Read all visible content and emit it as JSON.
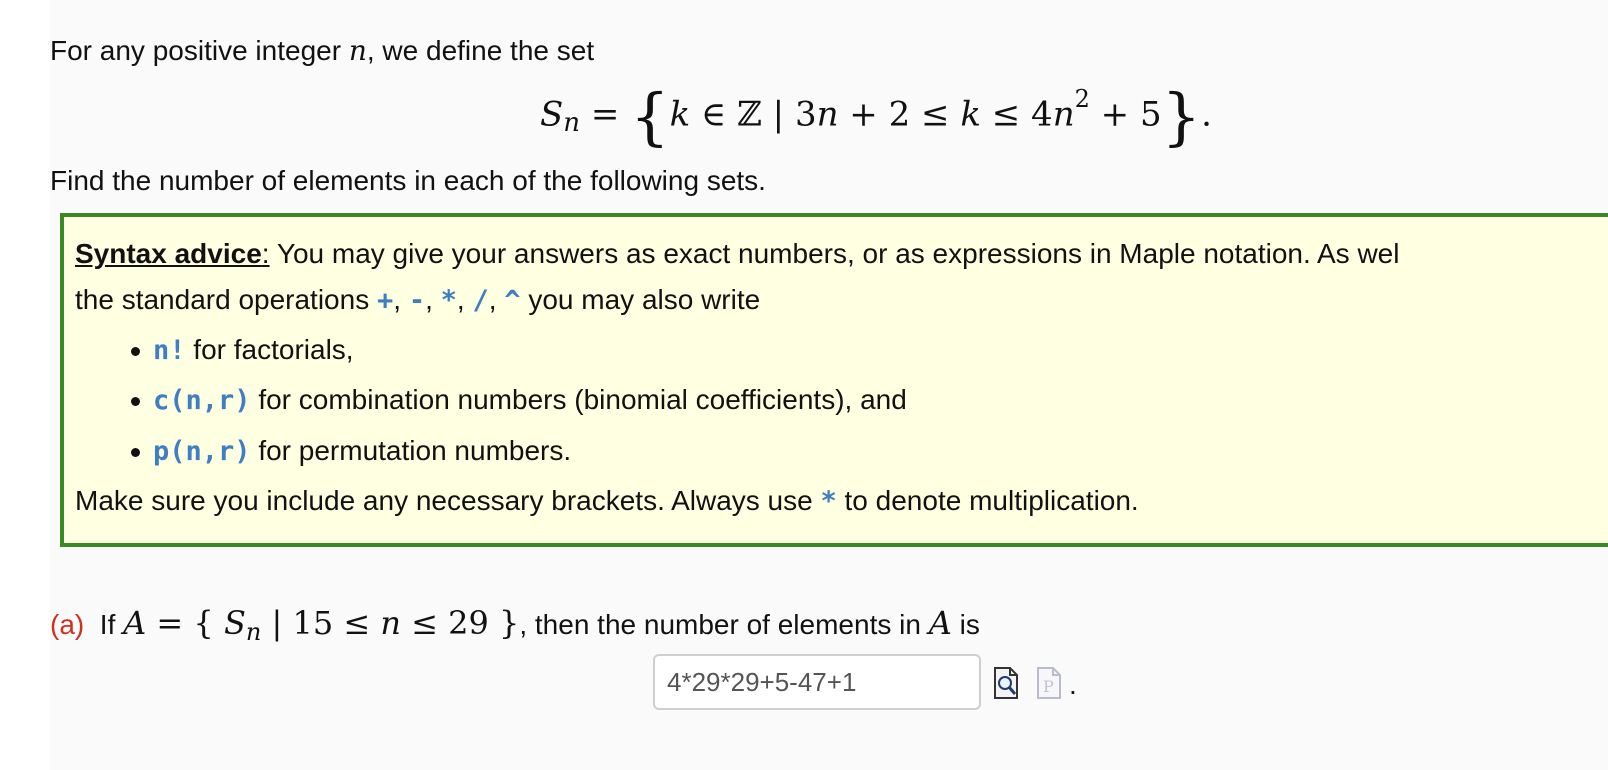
{
  "intro": {
    "line1_prefix": "For any positive integer ",
    "line1_var": "n",
    "line1_suffix": ", we define the set",
    "line2": "Find the number of elements in each of the following sets."
  },
  "definition": {
    "lhs": "S",
    "lhs_sub": "n",
    "eq": "=",
    "open_brace": "{",
    "body_k": "k",
    "body_in": " ∈ ",
    "body_Z": "ℤ",
    "body_bar": " | ",
    "body_lower": "3",
    "body_n1": "n",
    "body_plus2": " + 2 ≤ ",
    "body_k2": "k",
    "body_le": " ≤ 4",
    "body_n2": "n",
    "body_sq": "2",
    "body_plus5": " + 5",
    "close_brace": "}",
    "period": "."
  },
  "advice": {
    "title": "Syntax advice",
    "colon": ":",
    "line1": "  You may give your answers as exact numbers, or as expressions in Maple notation.  As wel",
    "line2_prefix": "the standard operations ",
    "ops": [
      "+",
      "-",
      "*",
      "/",
      "^"
    ],
    "sep": ", ",
    "line2_suffix": " you may also write",
    "bullets": [
      {
        "code": "n!",
        "text": " for factorials,"
      },
      {
        "code": "c(n,r)",
        "text": " for combination numbers (binomial coefficients), and"
      },
      {
        "code": "p(n,r)",
        "text": " for permutation numbers."
      }
    ],
    "last_prefix": "Make sure you include any necessary brackets. Always use ",
    "last_code": "*",
    "last_suffix": " to denote multiplication."
  },
  "part_a": {
    "label": "(a)",
    "if": "If ",
    "A": "A",
    "eq": " = { ",
    "S": "S",
    "S_sub": "n",
    "cond": " | 15 ≤ ",
    "n": "n",
    "cond2": " ≤ 29 }",
    "then": ", then the number of elements in ",
    "A2": "A",
    "is": " is",
    "answer_value": "4*29*29+5-47+1",
    "period": "."
  },
  "icons": {
    "preview": "preview-magnifier-icon",
    "syntax": "syntax-help-icon"
  },
  "colors": {
    "advice_bg": "#ffffe1",
    "advice_border": "#3a8a24",
    "code": "#3f7ec2",
    "part_label": "#d0301f"
  }
}
